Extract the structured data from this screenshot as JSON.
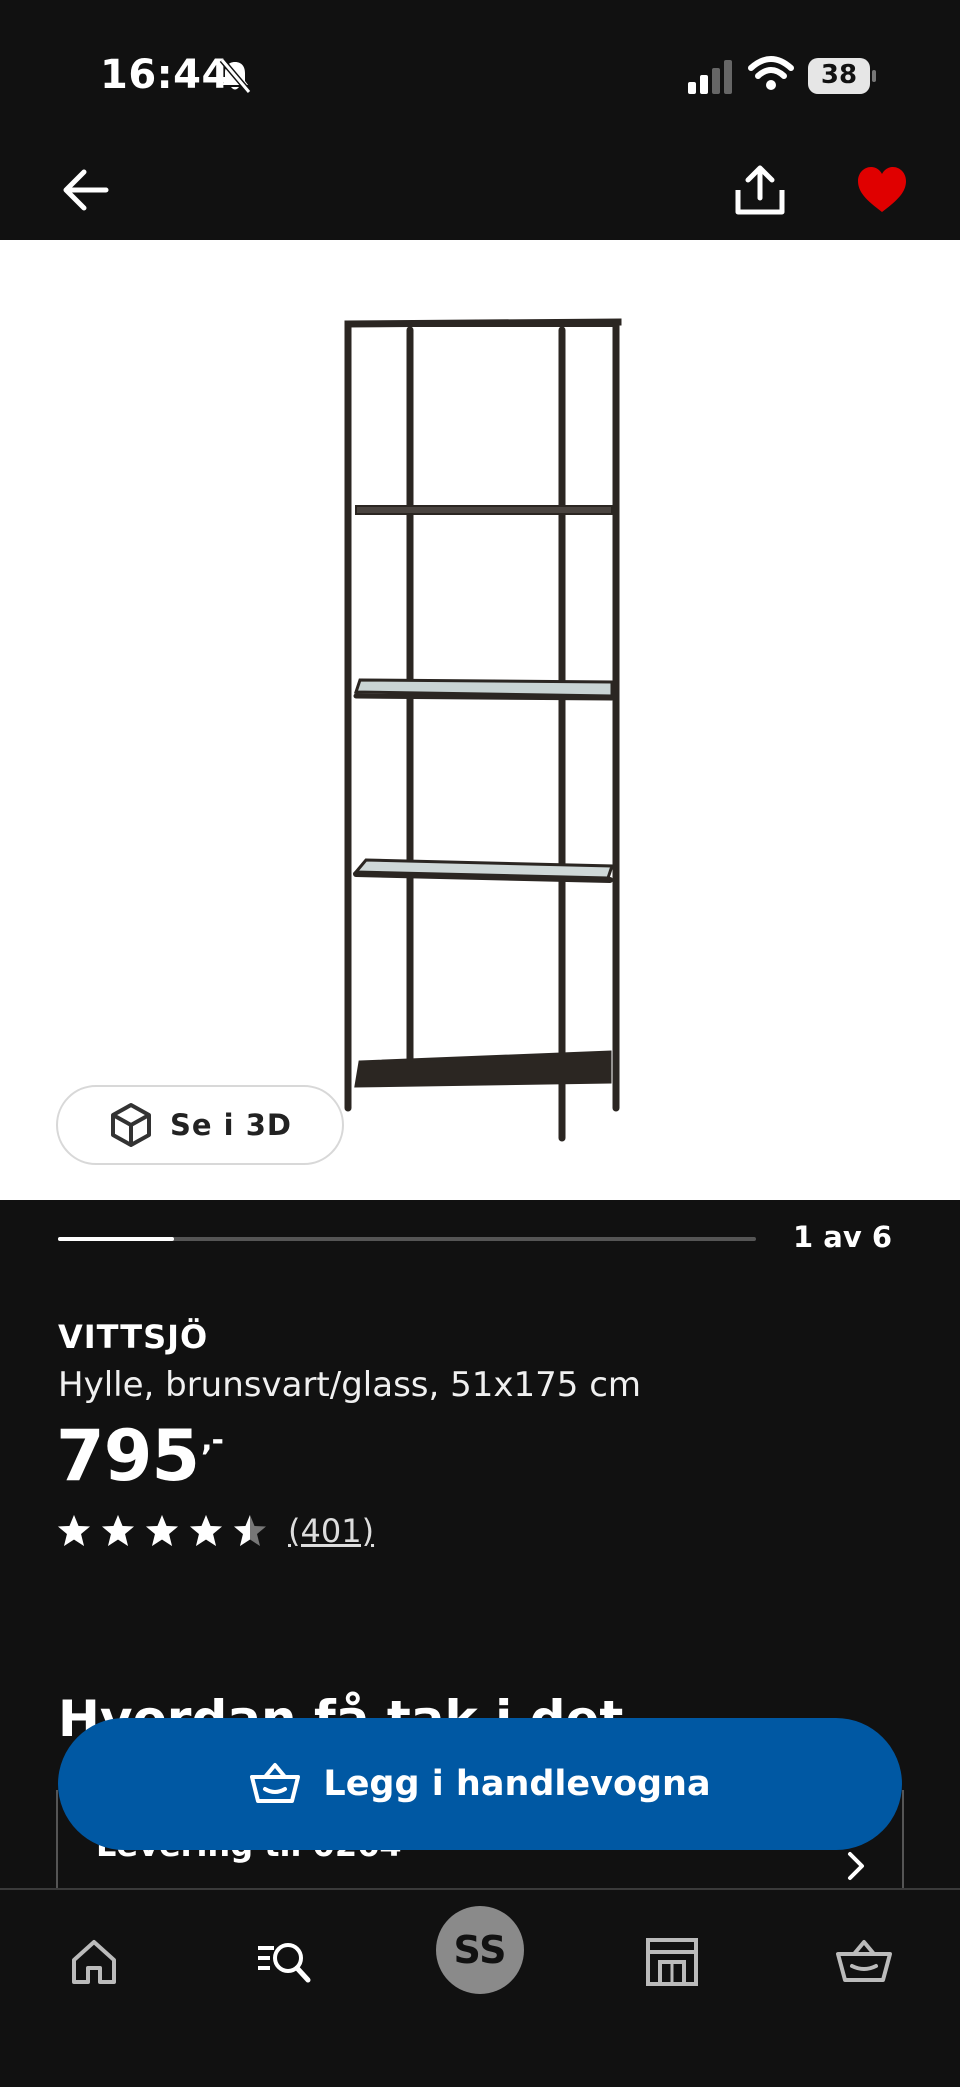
{
  "status_bar": {
    "time": "16:44",
    "battery": "38",
    "icons": [
      "bell-slash-icon",
      "signal-icon",
      "wifi-icon",
      "battery-icon"
    ]
  },
  "header": {
    "back_icon": "arrow-left-icon",
    "share_icon": "share-icon",
    "favorite_icon": "heart-icon",
    "favorite_color": "#e00000"
  },
  "gallery": {
    "view_3d_label": "Se i 3D",
    "pager_text": "1 av 6",
    "current_index": 1,
    "total": 6
  },
  "product": {
    "name": "VITTSJÖ",
    "description": "Hylle, brunsvart/glass, 51x175 cm",
    "price": "795",
    "price_suffix": ",-",
    "rating": 4.5,
    "rating_max": 5,
    "review_count": "(401)"
  },
  "availability": {
    "heading": "Hvordan få tak i det",
    "delivery_label": "Levering til 0264"
  },
  "cart_button": {
    "label": "Legg i handlevogna",
    "color": "#0058a3"
  },
  "bottom_nav": {
    "items": [
      "home-icon",
      "search-list-icon",
      "profile-avatar",
      "store-icon",
      "cart-icon"
    ],
    "avatar_initials": "SS"
  }
}
